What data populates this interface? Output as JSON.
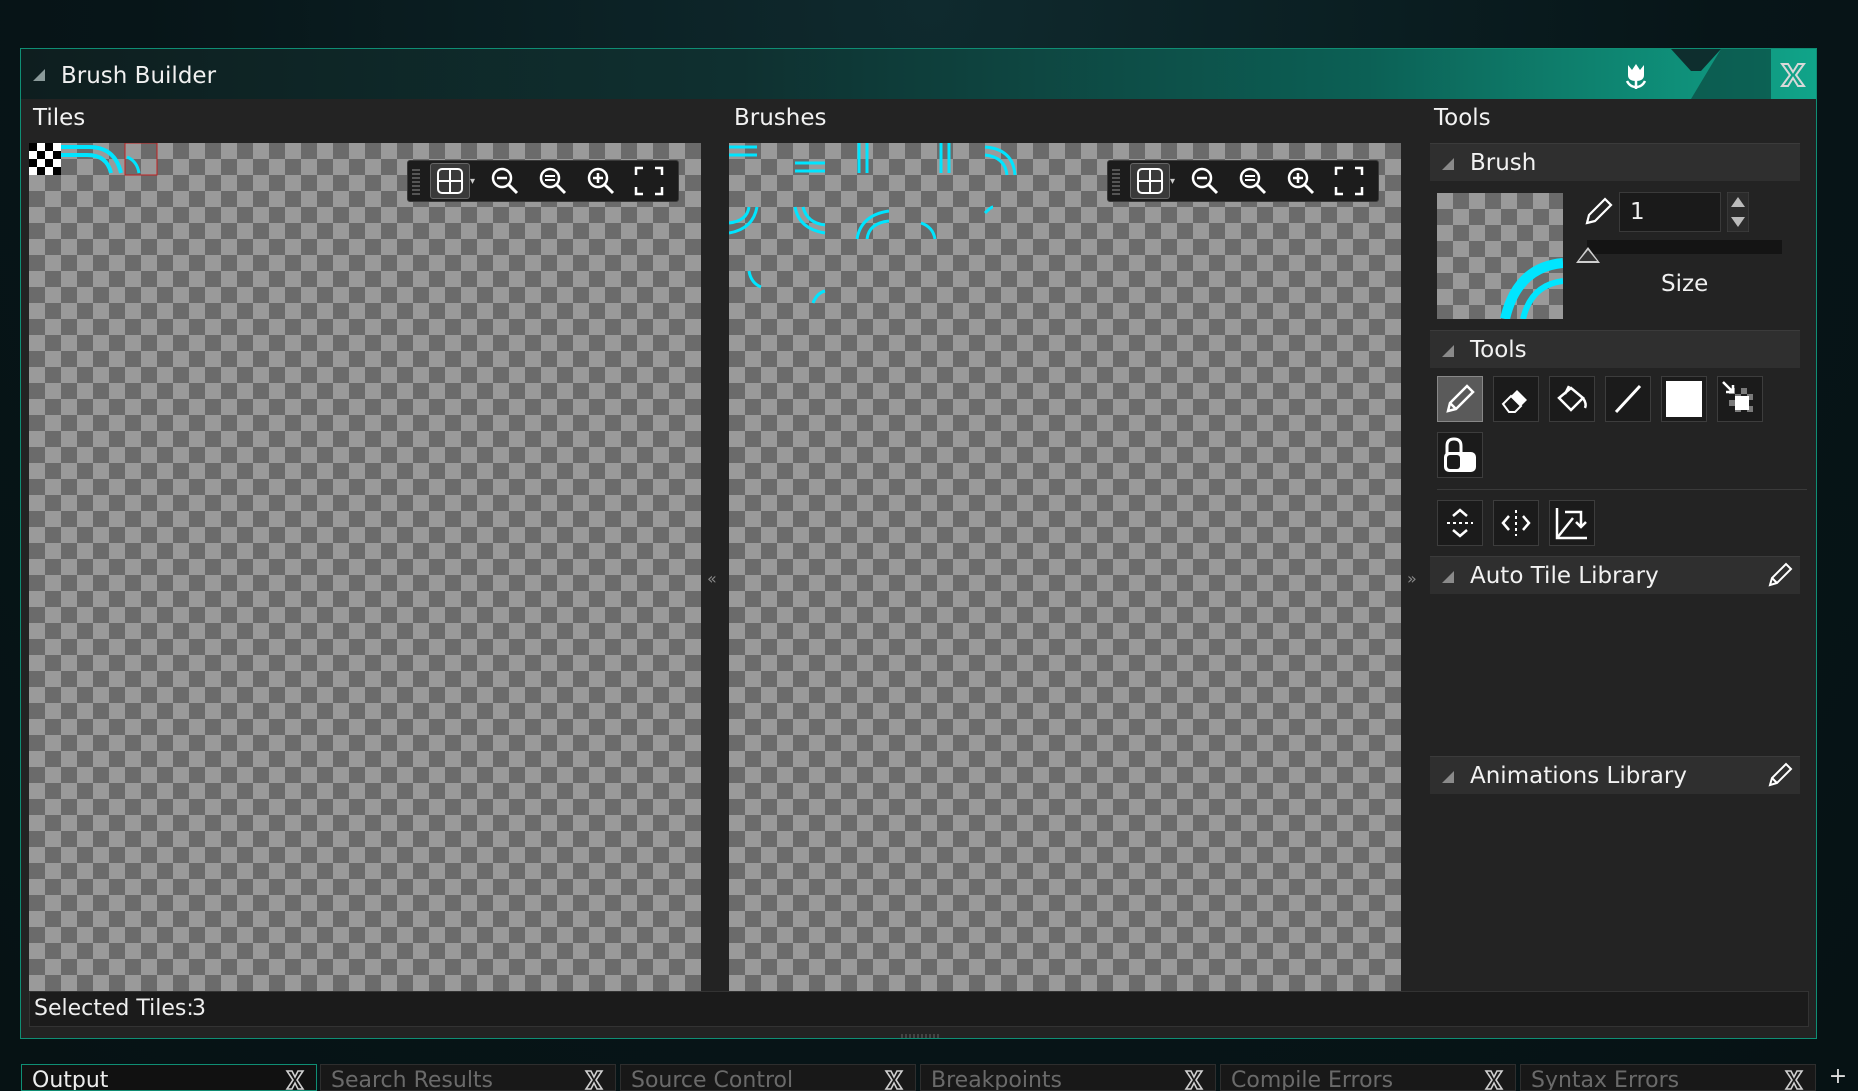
{
  "window": {
    "title": "Brush Builder"
  },
  "panes": {
    "tiles_label": "Tiles",
    "brushes_label": "Brushes",
    "tools_label": "Tools"
  },
  "canvas_toolbar": {
    "icons": [
      "grid-icon",
      "zoom-out-icon",
      "zoom-reset-icon",
      "zoom-in-icon",
      "fullscreen-icon"
    ]
  },
  "tools_panel": {
    "brush_section": "Brush",
    "size_value": "1",
    "size_label": "Size",
    "tools_section": "Tools",
    "tools": [
      "pencil-icon",
      "eraser-icon",
      "fill-bucket-icon",
      "line-icon",
      "rectangle-icon",
      "pick-tile-icon",
      "lock-icon"
    ],
    "transforms": [
      "flip-vertical-icon",
      "flip-horizontal-icon",
      "rotate-icon"
    ],
    "auto_tile_section": "Auto Tile Library",
    "animations_section": "Animations Library"
  },
  "status": {
    "label": "Selected Tiles:",
    "value": "3"
  },
  "bottom_tabs": [
    {
      "label": "Output",
      "active": true
    },
    {
      "label": "Search Results",
      "active": false
    },
    {
      "label": "Source Control",
      "active": false
    },
    {
      "label": "Breakpoints",
      "active": false
    },
    {
      "label": "Compile Errors",
      "active": false
    },
    {
      "label": "Syntax Errors",
      "active": false
    }
  ],
  "colors": {
    "accent": "#10a489",
    "tile_cyan": "#00e5ff",
    "panel_bg": "#232323"
  }
}
